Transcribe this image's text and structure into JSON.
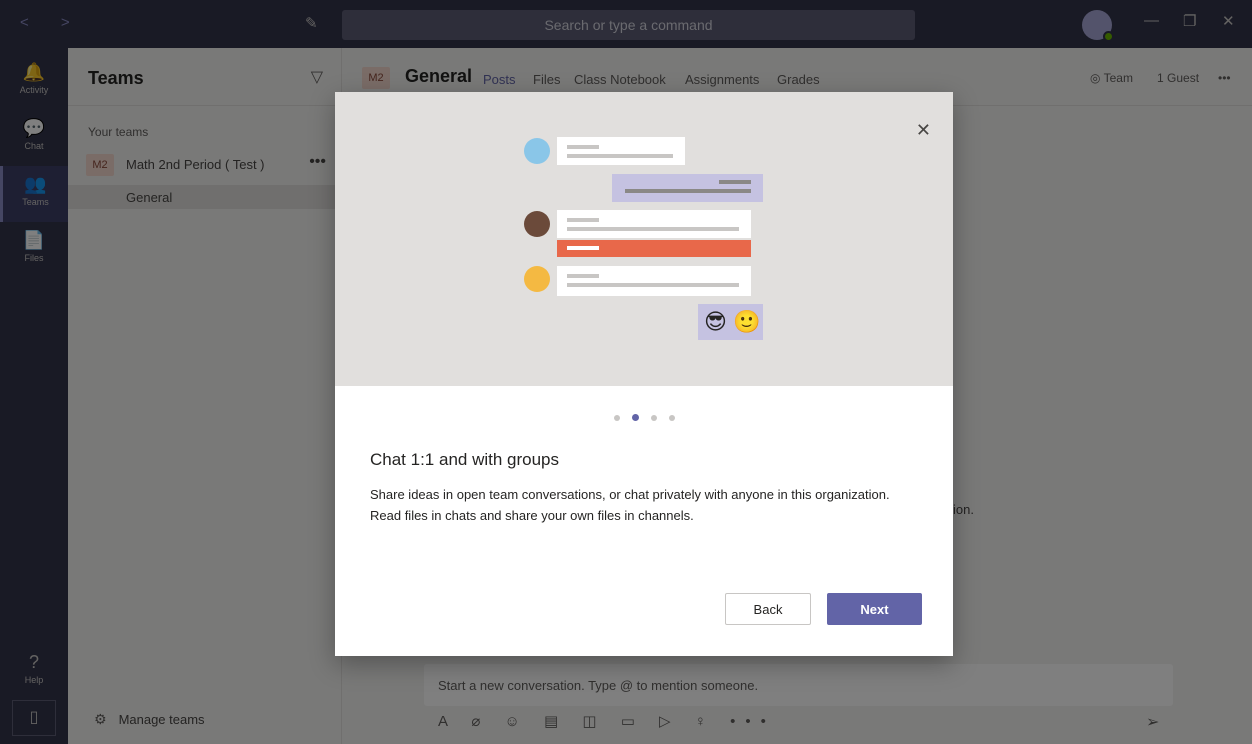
{
  "titlebar": {
    "search_placeholder": "Search or type a command",
    "nav_arrows": "< >",
    "compose_glyph": "✎",
    "minimize_glyph": "—",
    "restore_glyph": "❐",
    "close_glyph": "✕",
    "presence_color": "#6bb700"
  },
  "appbar": {
    "items": [
      {
        "label": "Activity",
        "icon": "bell-icon",
        "glyph": "🔔"
      },
      {
        "label": "Chat",
        "icon": "chat-icon",
        "glyph": "💬"
      },
      {
        "label": "Teams",
        "icon": "teams-icon",
        "glyph": "👥"
      },
      {
        "label": "Files",
        "icon": "files-icon",
        "glyph": "📄"
      },
      {
        "label": "Help",
        "icon": "help-icon",
        "glyph": "?"
      }
    ],
    "device_glyph": "▯"
  },
  "teams_panel": {
    "title": "Teams",
    "filter_glyph": "▽",
    "section_label": "Your teams",
    "team": {
      "badge": "M2",
      "name": "Math 2nd Period ( Test )",
      "more": "•••"
    },
    "channel": {
      "name": "General"
    },
    "manage_label": "Manage teams",
    "manage_glyph": "⚙"
  },
  "channel_header": {
    "badge": "M2",
    "title": "General",
    "tabs": [
      "Posts",
      "Files",
      "Class Notebook",
      "Assignments",
      "Grades"
    ],
    "active_tab": "Posts",
    "team_label": "Team",
    "guest_label": "1 Guest",
    "more": "•••"
  },
  "compose": {
    "placeholder": "Start a new conversation. Type @ to mention someone.",
    "tools_glyphs": "A ⌀ ☺ ▤ ◫ ▭ ▷ ♀ •••",
    "send_glyph": "➢"
  },
  "background_partial_text": "ion.",
  "dialog": {
    "close_glyph": "✕",
    "page_count": 4,
    "active_page": 2,
    "title": "Chat 1:1 and with groups",
    "body": "Share ideas in open team conversations, or chat privately with anyone in this organization. Read files in chats and share your own files in channels.",
    "back_label": "Back",
    "next_label": "Next",
    "accent_color": "#6264a7",
    "emojis": [
      "😎",
      "🙂"
    ]
  }
}
